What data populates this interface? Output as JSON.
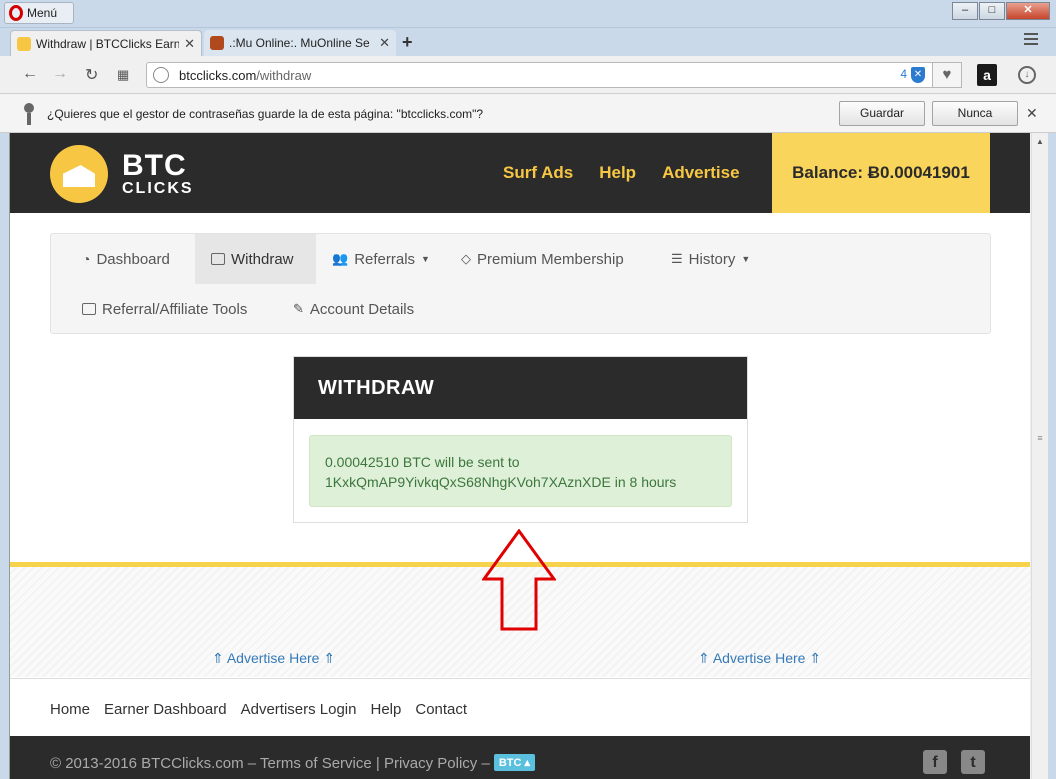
{
  "browser": {
    "menu_label": "Menú",
    "tabs": [
      {
        "title": "Withdraw | BTCClicks Earn"
      },
      {
        "title": ".:Mu Online:. MuOnline Se"
      }
    ],
    "url_domain": "btcclicks.com",
    "url_path": "/withdraw",
    "badge_count": "4",
    "password_prompt": "¿Quieres que el gestor de contraseñas guarde la de esta página: \"btcclicks.com\"?",
    "save_label": "Guardar",
    "never_label": "Nunca"
  },
  "site": {
    "logo_big": "BTC",
    "logo_small": "CLICKS",
    "nav": [
      "Surf Ads",
      "Help",
      "Advertise"
    ],
    "balance": "Balance: Ƀ0.00041901",
    "subnav": {
      "dashboard": "Dashboard",
      "withdraw": "Withdraw",
      "referrals": "Referrals",
      "premium": "Premium Membership",
      "history": "History",
      "tools": "Referral/Affiliate Tools",
      "account": "Account Details"
    },
    "withdraw_title": "WITHDRAW",
    "withdraw_msg_line1": "0.00042510 BTC will be sent to",
    "withdraw_msg_line2": "1KxkQmAP9YivkqQxS68NhgKVoh7XAznXDE in 8 hours",
    "ad_left": "⇑ Advertise Here ⇑",
    "ad_right": "⇑ Advertise Here ⇑",
    "footer_links": [
      "Home",
      "Earner Dashboard",
      "Advertisers Login",
      "Help",
      "Contact"
    ],
    "copyright": "© 2013-2016 BTCClicks.com – Terms of Service | Privacy Policy –",
    "btc_badge": "BTC ▴"
  },
  "colors": {
    "brand_yellow": "#f7c744",
    "header_dark": "#2b2b2b",
    "alert_green_bg": "#dff0d8",
    "alert_green_text": "#3c763d",
    "annotation_red": "#e00000"
  }
}
